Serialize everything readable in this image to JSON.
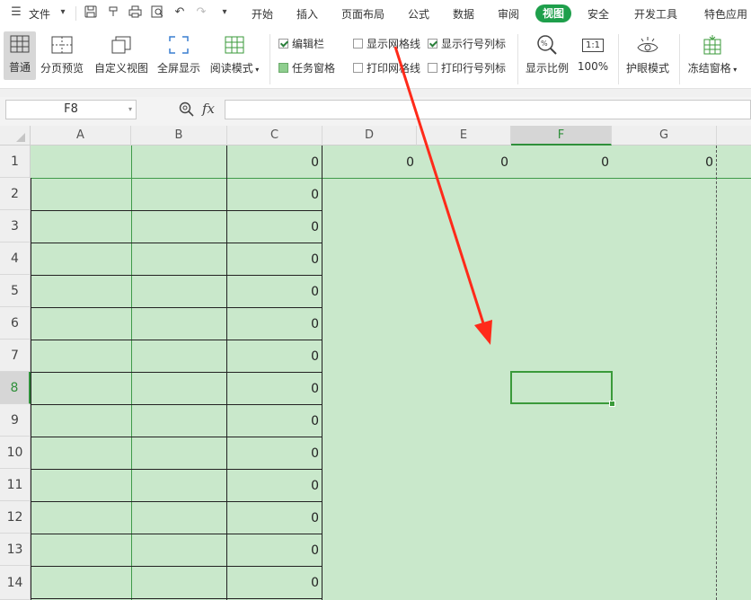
{
  "menu": {
    "file_label": "文件",
    "tabs": [
      "开始",
      "插入",
      "页面布局",
      "公式",
      "数据",
      "审阅",
      "视图",
      "安全",
      "开发工具",
      "特色应用"
    ],
    "active_tab": "视图"
  },
  "ribbon": {
    "buttons": [
      "普通",
      "分页预览",
      "自定义视图",
      "全屏显示",
      "阅读模式",
      "显示比例",
      "100%",
      "护眼模式",
      "冻结窗格"
    ],
    "ratio_icon_text": "1:1",
    "checkboxes": {
      "formula_bar": {
        "label": "编辑栏",
        "checked": true
      },
      "task_pane": {
        "label": "任务窗格",
        "checked": true
      },
      "show_gridlines": {
        "label": "显示网格线",
        "checked": false
      },
      "print_gridlines": {
        "label": "打印网格线",
        "checked": false
      },
      "show_headers": {
        "label": "显示行号列标",
        "checked": true
      },
      "print_headers": {
        "label": "打印行号列标",
        "checked": false
      }
    }
  },
  "formula_bar": {
    "name_box": "F8",
    "fx_label": "fx",
    "value": ""
  },
  "sheet": {
    "columns": [
      "A",
      "B",
      "C",
      "D",
      "E",
      "F",
      "G"
    ],
    "rows": [
      "1",
      "2",
      "3",
      "4",
      "5",
      "6",
      "7",
      "8",
      "9",
      "10",
      "11",
      "12",
      "13",
      "14"
    ],
    "selected_cell": "F8",
    "row1_values": {
      "C": "0",
      "D": "0",
      "E": "0",
      "F": "0",
      "G": "0"
    },
    "column_c_values": [
      "0",
      "0",
      "0",
      "0",
      "0",
      "0",
      "0",
      "0",
      "0",
      "0",
      "0",
      "0",
      "0"
    ]
  },
  "colors": {
    "accent": "#1e9f4b",
    "sheet_background": "#c9e8cb",
    "arrow": "#ff2a1a",
    "selection_border": "#3a9a3a"
  }
}
